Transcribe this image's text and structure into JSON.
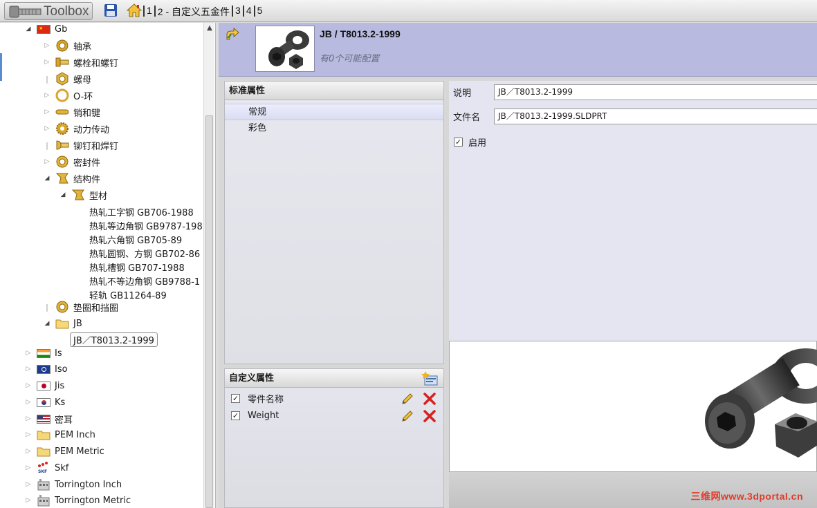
{
  "toolbar": {
    "title": "Toolbox",
    "breadcrumbs": [
      "1",
      "2 - 自定义五金件",
      "3",
      "4",
      "5"
    ]
  },
  "tree": {
    "items": [
      {
        "label": "Gb",
        "icon": "china-flag-icon"
      },
      {
        "label": "轴承",
        "icon": "bearing-icon"
      },
      {
        "label": "螺栓和螺钉",
        "icon": "bolt-icon"
      },
      {
        "label": "螺母",
        "icon": "nut-icon"
      },
      {
        "label": "O-环",
        "icon": "o-ring-icon"
      },
      {
        "label": "销和键",
        "icon": "pin-icon"
      },
      {
        "label": "动力传动",
        "icon": "gear-icon"
      },
      {
        "label": "铆钉和焊钉",
        "icon": "rivet-icon"
      },
      {
        "label": "密封件",
        "icon": "seal-icon"
      },
      {
        "label": "结构件",
        "icon": "structure-icon"
      },
      {
        "label": "型材",
        "icon": "profile-icon"
      },
      {
        "label": "热轧工字钢 GB706-1988"
      },
      {
        "label": "热轧等边角钢 GB9787-198"
      },
      {
        "label": "热轧六角钢 GB705-89"
      },
      {
        "label": "热轧圆钢、方钢 GB702-86"
      },
      {
        "label": "热轧槽钢 GB707-1988"
      },
      {
        "label": "热轧不等边角钢 GB9788-1"
      },
      {
        "label": "轻轨 GB11264-89"
      },
      {
        "label": "垫圈和挡圈",
        "icon": "washer-icon"
      },
      {
        "label": "JB",
        "icon": "folder-icon"
      },
      {
        "label": "JB／T8013.2-1999"
      },
      {
        "label": "Is",
        "icon": "india-flag-icon"
      },
      {
        "label": "Iso",
        "icon": "iso-icon"
      },
      {
        "label": "Jis",
        "icon": "japan-flag-icon"
      },
      {
        "label": "Ks",
        "icon": "korea-flag-icon"
      },
      {
        "label": "密耳",
        "icon": "us-flag-icon"
      },
      {
        "label": "PEM Inch",
        "icon": "folder-icon"
      },
      {
        "label": "PEM Metric",
        "icon": "folder-icon"
      },
      {
        "label": "Skf",
        "icon": "skf-icon"
      },
      {
        "label": "Torrington Inch",
        "icon": "factory-icon"
      },
      {
        "label": "Torrington Metric",
        "icon": "factory-icon"
      }
    ]
  },
  "header": {
    "title": "JB / T8013.2-1999",
    "subtitle": "有0个可能配置"
  },
  "standard_props": {
    "title": "标准属性",
    "items": [
      "常规",
      "彩色"
    ],
    "active": "常规"
  },
  "custom_props": {
    "title": "自定义属性",
    "items": [
      {
        "label": "零件名称",
        "checked": true
      },
      {
        "label": "Weight",
        "checked": true
      }
    ]
  },
  "form": {
    "description_label": "说明",
    "description_value": "JB／T8013.2-1999",
    "filename_label": "文件名",
    "filename_value": "JB／T8013.2-1999.SLDPRT",
    "enable_label": "启用",
    "enable_checked": true
  },
  "watermark": "三维网www.3dportal.cn",
  "colors": {
    "header_bg": "#b8bbdf",
    "delete_red": "#d42020",
    "accent_blue": "#2b55a8"
  }
}
